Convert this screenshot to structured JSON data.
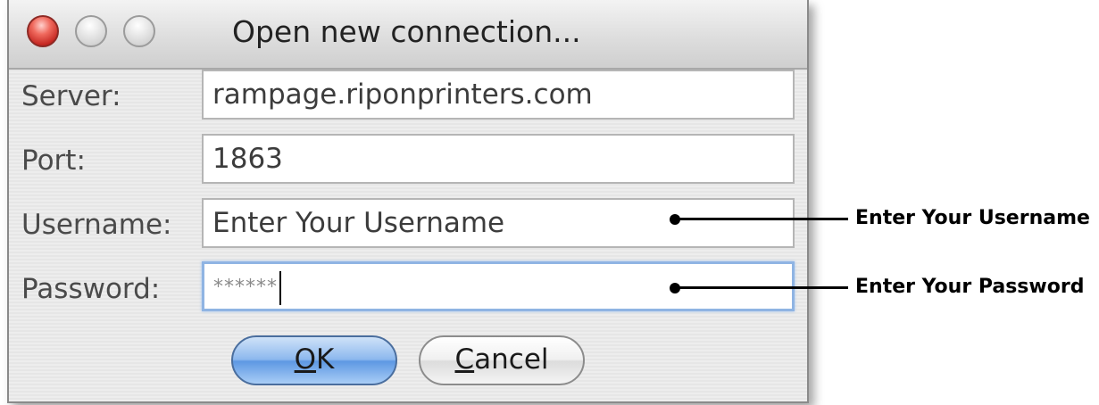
{
  "window": {
    "title": "Open new connection...",
    "fields": [
      {
        "label": "Server:",
        "value": "rampage.riponprinters.com"
      },
      {
        "label": "Port:",
        "value": "1863"
      },
      {
        "label": "Username:",
        "value": "Enter Your Username"
      },
      {
        "label": "Password:",
        "value": "******"
      }
    ],
    "buttons": {
      "ok_mnemonic": "O",
      "ok_rest": "K",
      "cancel_mnemonic": "C",
      "cancel_rest": "ancel"
    }
  },
  "annotations": {
    "username": "Enter Your Username",
    "password": "Enter Your Password"
  },
  "colors": {
    "close_button": "#e0443b",
    "focus_ring": "#8fb4e3",
    "default_button": "#6fa3e6"
  },
  "icons": [
    "close-window-icon",
    "minimize-window-icon",
    "zoom-window-icon"
  ]
}
